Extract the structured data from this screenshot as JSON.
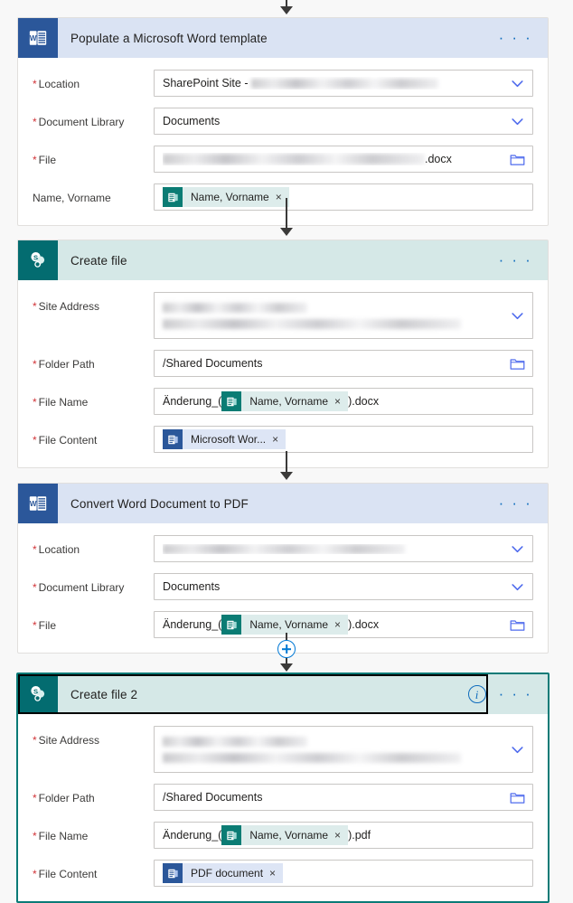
{
  "flow": {
    "cards": [
      {
        "id": "populate-word-template",
        "title": "Populate a Microsoft Word template",
        "connector": "word",
        "icon": "word-icon",
        "selected": false,
        "show_info": false,
        "menu_label": "· · ·",
        "fields": [
          {
            "label": "Location",
            "required": true,
            "kind": "text-blur",
            "value": "SharePoint Site - ",
            "redacted": true,
            "trailing": "chevron-down-icon"
          },
          {
            "label": "Document Library",
            "required": true,
            "kind": "text",
            "value": "Documents",
            "trailing": "chevron-down-icon"
          },
          {
            "label": "File",
            "required": true,
            "kind": "blur-suffix",
            "suffix": ".docx",
            "trailing": "folder-icon"
          },
          {
            "label": "Name, Vorname",
            "required": false,
            "kind": "chip-only",
            "chip": {
              "label": "Name, Vorname",
              "style": "teal",
              "icon": "office-token-icon",
              "remove": "×"
            }
          }
        ]
      },
      {
        "id": "create-file",
        "title": "Create file",
        "connector": "sharepoint",
        "icon": "sharepoint-icon",
        "selected": false,
        "show_info": false,
        "menu_label": "· · ·",
        "fields": [
          {
            "label": "Site Address",
            "required": true,
            "kind": "two-blur",
            "trailing": "chevron-down-icon"
          },
          {
            "label": "Folder Path",
            "required": true,
            "kind": "text",
            "value": "/Shared Documents",
            "trailing": "folder-icon"
          },
          {
            "label": "File Name",
            "required": true,
            "kind": "prefix-chip-suffix",
            "prefix": "Änderung_(",
            "suffix": ").docx",
            "chip": {
              "label": "Name, Vorname",
              "style": "teal",
              "icon": "office-token-icon",
              "remove": "×"
            }
          },
          {
            "label": "File Content",
            "required": true,
            "kind": "chip-only",
            "chip": {
              "label": "Microsoft Wor...",
              "style": "blue",
              "icon": "word-token-icon",
              "remove": "×"
            }
          }
        ]
      },
      {
        "id": "convert-word-to-pdf",
        "title": "Convert Word Document to PDF",
        "connector": "word",
        "icon": "word-icon",
        "selected": false,
        "show_info": false,
        "menu_label": "· · ·",
        "fields": [
          {
            "label": "Location",
            "required": true,
            "kind": "blur-only",
            "trailing": "chevron-down-icon"
          },
          {
            "label": "Document Library",
            "required": true,
            "kind": "text",
            "value": "Documents",
            "trailing": "chevron-down-icon"
          },
          {
            "label": "File",
            "required": true,
            "kind": "prefix-chip-suffix",
            "prefix": "Änderung_(",
            "suffix": ").docx",
            "chip": {
              "label": "Name, Vorname",
              "style": "teal",
              "icon": "office-token-icon",
              "remove": "×"
            },
            "trailing": "folder-icon"
          }
        ]
      },
      {
        "id": "create-file-2",
        "title": "Create file 2",
        "connector": "sharepoint",
        "icon": "sharepoint-icon",
        "selected": true,
        "show_info": true,
        "menu_label": "· · ·",
        "fields": [
          {
            "label": "Site Address",
            "required": true,
            "kind": "two-blur",
            "trailing": "chevron-down-icon"
          },
          {
            "label": "Folder Path",
            "required": true,
            "kind": "text",
            "value": "/Shared Documents",
            "trailing": "folder-icon"
          },
          {
            "label": "File Name",
            "required": true,
            "kind": "prefix-chip-suffix",
            "prefix": "Änderung_(",
            "suffix": ").pdf",
            "chip": {
              "label": "Name, Vorname",
              "style": "teal",
              "icon": "office-token-icon",
              "remove": "×"
            }
          },
          {
            "label": "File Content",
            "required": true,
            "kind": "chip-only",
            "chip": {
              "label": "PDF document",
              "style": "blue",
              "icon": "word-token-icon",
              "remove": "×"
            }
          }
        ]
      }
    ],
    "insert_step_tooltip": "Insert a new step",
    "required_marker": "*"
  },
  "colors": {
    "word_header": "#dae3f3",
    "sharepoint_header": "#d5e8e7",
    "word_icon": "#2b579a",
    "sharepoint_icon": "#036c70",
    "selected_border": "#0a7b77",
    "accent_blue": "#0078d4",
    "required_red": "#d13438"
  }
}
